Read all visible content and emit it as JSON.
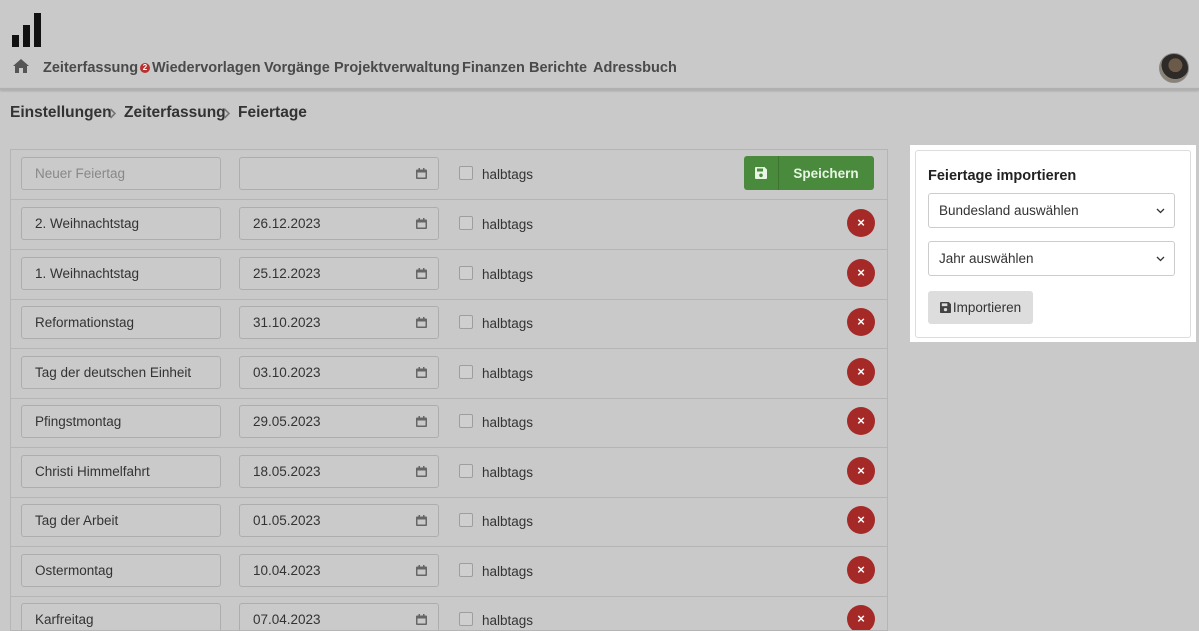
{
  "nav": {
    "items": [
      "Zeiterfassung",
      "Wiedervorlagen",
      "Vorgänge",
      "Projektverwaltung",
      "Finanzen",
      "Berichte",
      "Adressbuch"
    ],
    "wiedervorlagen_badge": "2"
  },
  "breadcrumb": [
    "Einstellungen",
    "Zeiterfassung",
    "Feiertage"
  ],
  "new_entry": {
    "name_placeholder": "Neuer Feiertag",
    "date_value": "",
    "halfday_label": "halbtags",
    "save_label": "Speichern"
  },
  "holidays": [
    {
      "name": "2. Weihnachtstag",
      "date": "26.12.2023",
      "halfday_label": "halbtags",
      "delete": "×"
    },
    {
      "name": "1. Weihnachtstag",
      "date": "25.12.2023",
      "halfday_label": "halbtags",
      "delete": "×"
    },
    {
      "name": "Reformationstag",
      "date": "31.10.2023",
      "halfday_label": "halbtags",
      "delete": "×"
    },
    {
      "name": "Tag der deutschen Einheit",
      "date": "03.10.2023",
      "halfday_label": "halbtags",
      "delete": "×"
    },
    {
      "name": "Pfingstmontag",
      "date": "29.05.2023",
      "halfday_label": "halbtags",
      "delete": "×"
    },
    {
      "name": "Christi Himmelfahrt",
      "date": "18.05.2023",
      "halfday_label": "halbtags",
      "delete": "×"
    },
    {
      "name": "Tag der Arbeit",
      "date": "01.05.2023",
      "halfday_label": "halbtags",
      "delete": "×"
    },
    {
      "name": "Ostermontag",
      "date": "10.04.2023",
      "halfday_label": "halbtags",
      "delete": "×"
    },
    {
      "name": "Karfreitag",
      "date": "07.04.2023",
      "halfday_label": "halbtags",
      "delete": "×"
    }
  ],
  "import": {
    "title": "Feiertage importieren",
    "state_select": "Bundesland auswählen",
    "year_select": "Jahr auswählen",
    "button_label": "Importieren"
  },
  "colors": {
    "save_green": "#4a8a3c",
    "delete_red": "#a52a27",
    "badge_red": "#b8312f"
  }
}
